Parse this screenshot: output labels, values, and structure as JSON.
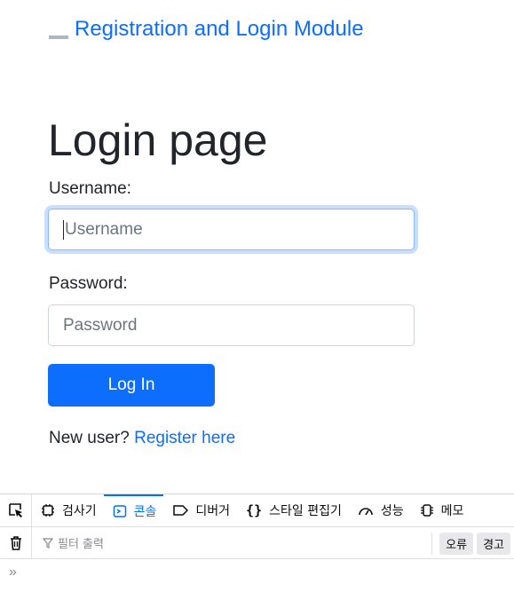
{
  "navbar": {
    "brand": "Registration and Login Module"
  },
  "login": {
    "title": "Login page",
    "username_label": "Username:",
    "username_placeholder": "Username",
    "password_label": "Password:",
    "password_placeholder": "Password",
    "submit_label": "Log In",
    "register_prompt": "New user? ",
    "register_link": "Register here"
  },
  "devtools": {
    "tabs": [
      {
        "label": "검사기",
        "icon": "inspector-icon"
      },
      {
        "label": "콘솔",
        "icon": "console-icon",
        "active": true
      },
      {
        "label": "디버거",
        "icon": "debugger-icon"
      },
      {
        "label": "스타일 편집기",
        "icon": "style-editor-icon"
      },
      {
        "label": "성능",
        "icon": "performance-icon"
      },
      {
        "label": "메모",
        "icon": "memory-icon"
      }
    ],
    "filter_placeholder": "필터 출력",
    "chips": [
      "오류",
      "경고"
    ],
    "prompt_symbol": "»"
  },
  "colors": {
    "primary": "#0d6efd",
    "devtools_active": "#0074e8"
  }
}
